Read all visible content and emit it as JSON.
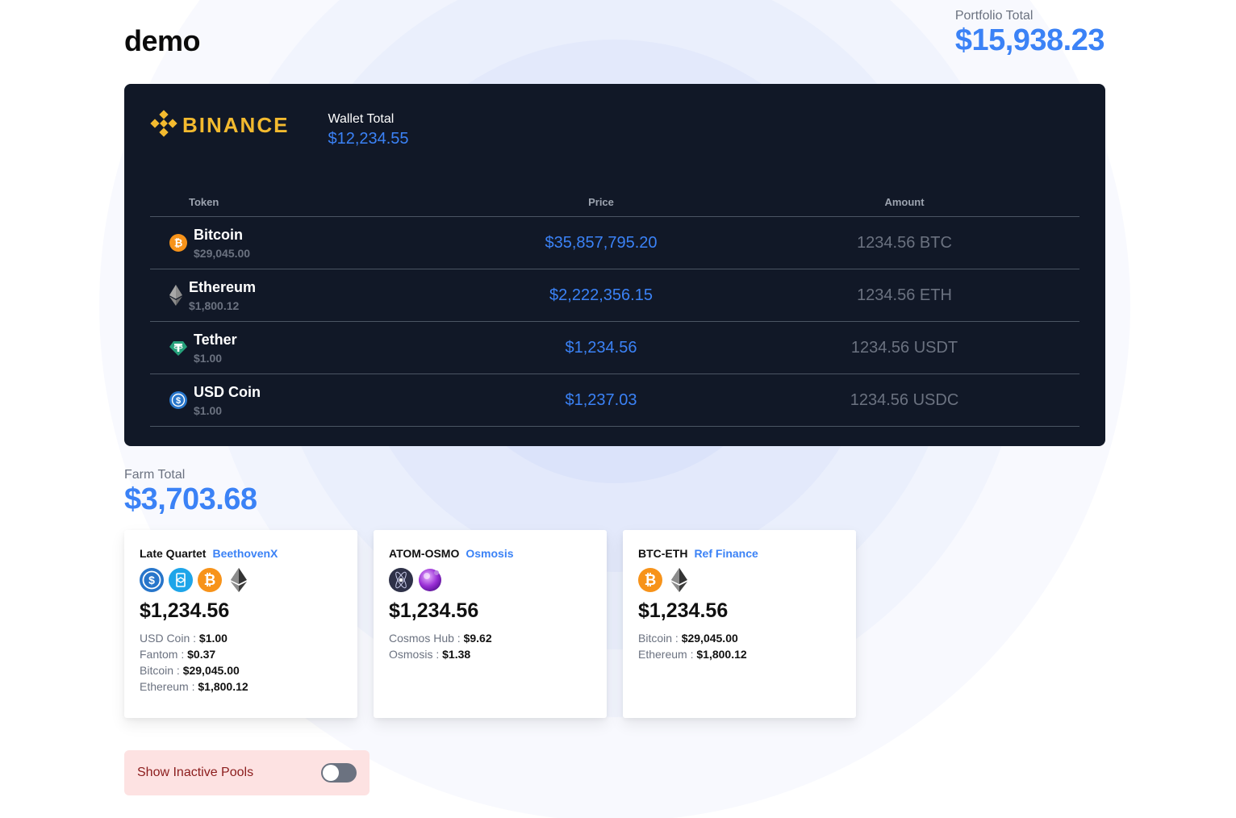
{
  "page": {
    "title": "demo"
  },
  "portfolio": {
    "label": "Portfolio Total",
    "value": "$15,938.23"
  },
  "wallet": {
    "logo_text": "BINANCE",
    "logo_icon": "binance-logo-icon",
    "total_label": "Wallet Total",
    "total_value": "$12,234.55",
    "columns": {
      "token": "Token",
      "price": "Price",
      "amount": "Amount"
    },
    "rows": [
      {
        "name": "Bitcoin",
        "unit_price": "$29,045.00",
        "price": "$35,857,795.20",
        "amount": "1234.56 BTC",
        "icon": "bitcoin-icon"
      },
      {
        "name": "Ethereum",
        "unit_price": "$1,800.12",
        "price": "$2,222,356.15",
        "amount": "1234.56 ETH",
        "icon": "ethereum-icon"
      },
      {
        "name": "Tether",
        "unit_price": "$1.00",
        "price": "$1,234.56",
        "amount": "1234.56 USDT",
        "icon": "tether-icon"
      },
      {
        "name": "USD Coin",
        "unit_price": "$1.00",
        "price": "$1,237.03",
        "amount": "1234.56 USDC",
        "icon": "usd-coin-icon"
      }
    ]
  },
  "farm": {
    "label": "Farm Total",
    "value": "$3,703.68",
    "cards": [
      {
        "name": "Late Quartet",
        "protocol": "BeethovenX",
        "value": "$1,234.56",
        "icons": [
          "usd-coin-icon",
          "fantom-icon",
          "bitcoin-icon",
          "ethereum-icon"
        ],
        "lines": [
          {
            "label": "USD Coin :",
            "value": "$1.00"
          },
          {
            "label": "Fantom :",
            "value": "$0.37"
          },
          {
            "label": "Bitcoin :",
            "value": "$29,045.00"
          },
          {
            "label": "Ethereum :",
            "value": "$1,800.12"
          }
        ]
      },
      {
        "name": "ATOM-OSMO",
        "protocol": "Osmosis",
        "value": "$1,234.56",
        "icons": [
          "cosmos-hub-icon",
          "osmosis-icon"
        ],
        "lines": [
          {
            "label": "Cosmos Hub :",
            "value": "$9.62"
          },
          {
            "label": "Osmosis :",
            "value": "$1.38"
          }
        ]
      },
      {
        "name": "BTC-ETH",
        "protocol": "Ref Finance",
        "value": "$1,234.56",
        "icons": [
          "bitcoin-icon",
          "ethereum-icon"
        ],
        "lines": [
          {
            "label": "Bitcoin :",
            "value": "$29,045.00"
          },
          {
            "label": "Ethereum :",
            "value": "$1,800.12"
          }
        ]
      }
    ]
  },
  "inactive_toggle": {
    "label": "Show Inactive Pools",
    "checked": false
  },
  "colors": {
    "accent": "#3b82f6",
    "wallet_bg": "#111827",
    "binance": "#f3ba2f",
    "toggle_bg": "#fde2e2"
  }
}
